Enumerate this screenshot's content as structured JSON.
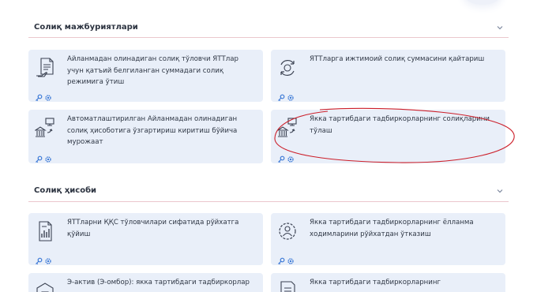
{
  "sections": [
    {
      "title": "Солиқ мажбуриятлари",
      "cards": [
        {
          "label": "Айланмадан олинадиган солиқ тўловчи ЯТТлар учун қатъий белгиланган суммадаги солиқ режимига ўтиш",
          "icon": "document-hand-icon"
        },
        {
          "label": "ЯТТларга ижтимоий солиқ суммасини қайтариш",
          "icon": "refresh-cycle-icon"
        },
        {
          "label": "Автоматлаштирилган Айланмадан олинадиган солиқ ҳисоботига ўзгартириш киритиш бўйича мурожаат",
          "icon": "bank-monitor-icon"
        },
        {
          "label": "Якка тартибдаги тадбиркорларнинг солиқларини тўлаш",
          "icon": "bank-monitor-icon"
        }
      ]
    },
    {
      "title": "Солиқ ҳисоби",
      "cards": [
        {
          "label": "ЯТТларни ҚҚС тўловчилари сифатида рўйхатга қўйиш",
          "icon": "report-chart-icon"
        },
        {
          "label": "Якка тартибдаги тадбиркорларнинг ёлланма ходимларини рўйхатдан ўтказиш",
          "icon": "person-gear-icon"
        },
        {
          "label": "Э-актив (Э-омбор): якка тартибдаги тадбиркорлар",
          "icon": "warehouse-box-icon"
        },
        {
          "label": "Якка тартибдаги тадбиркорларнинг комиссионерлари",
          "icon": "document-list-icon"
        }
      ]
    }
  ],
  "colors": {
    "accent": "#3a78d6",
    "card_bg": "#e9eff9",
    "annotation": "#cc1f2a"
  }
}
